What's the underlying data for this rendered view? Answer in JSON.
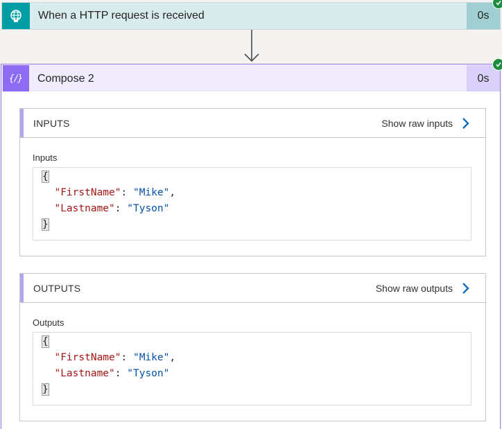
{
  "trigger": {
    "title": "When a HTTP request is received",
    "duration": "0s",
    "icon": "globe-request-icon",
    "status": "succeeded",
    "color": "#009da5"
  },
  "compose": {
    "title": "Compose 2",
    "duration": "0s",
    "icon": "curly-braces-expression-icon",
    "status": "succeeded",
    "color": "#8c6cf2"
  },
  "inputs_section": {
    "heading": "INPUTS",
    "raw_link": "Show raw inputs",
    "field_label": "Inputs",
    "json": {
      "open": "{",
      "close": "}",
      "firstname_key": "\"FirstName\"",
      "firstname_value": "\"Mike\"",
      "lastname_key": "\"Lastname\"",
      "lastname_value": "\"Tyson\""
    }
  },
  "outputs_section": {
    "heading": "OUTPUTS",
    "raw_link": "Show raw outputs",
    "field_label": "Outputs",
    "json": {
      "open": "{",
      "close": "}",
      "firstname_key": "\"FirstName\"",
      "firstname_value": "\"Mike\"",
      "lastname_key": "\"Lastname\"",
      "lastname_value": "\"Tyson\""
    }
  }
}
